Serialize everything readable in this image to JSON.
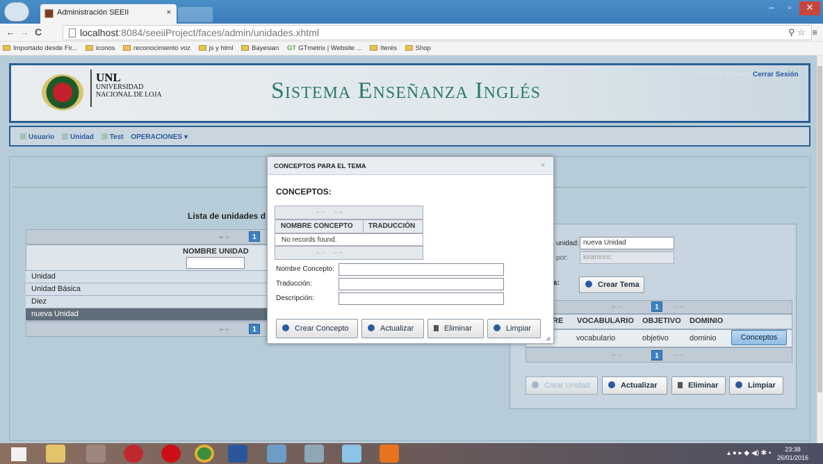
{
  "browser": {
    "tab_title": "Administración SEEII",
    "tab_close": "×",
    "url_host": "localhost",
    "url_rest": ":8084/seeiiProject/faces/admin/unidades.xhtml",
    "bookmarks": [
      "Importado desde Fir...",
      "iconos",
      "reconocimiento voz",
      "js y html",
      "Bayesian",
      "GTmetrix | Website ...",
      "Iterés",
      "Shop"
    ],
    "gt_prefix": "GT"
  },
  "header": {
    "unl": "UNL",
    "unl_sub": "UNIVERSIDAD NACIONAL DE LOJA",
    "logo_year": "1859",
    "system_title": "Sistema Enseñanza Inglés",
    "user_label": "Usuario: kiramonc",
    "logout": "Cerrar Sesión"
  },
  "menu": {
    "usuario": "Usuario",
    "unidad": "Unidad",
    "test": "Test",
    "operaciones": "OPERACIONES ▾"
  },
  "left": {
    "title": "Lista de unidades d",
    "column": "NOMBRE UNIDAD",
    "rows": [
      "Unidad",
      "Unidad Básica",
      "Diez",
      "nueva Unidad"
    ],
    "page": "1"
  },
  "right": {
    "nombre_label": "unidad:",
    "nombre_value": "nueva Unidad",
    "creado_label": "por:",
    "creado_value": "kiramonc",
    "temas_label": "s:",
    "crear_tema": "Crear Tema",
    "columns": [
      "RE",
      "VOCABULARIO",
      "OBJETIVO",
      "DOMINIO"
    ],
    "row": [
      "vocabulario",
      "objetivo",
      "dominio"
    ],
    "conceptos_btn": "Conceptos",
    "page": "1",
    "buttons": {
      "crear": "Crear Unidad",
      "actualizar": "Actualizar",
      "eliminar": "Eliminar",
      "limpiar": "Limpiar"
    }
  },
  "modal": {
    "title": "CONCEPTOS PARA EL TEMA",
    "close": "×",
    "heading": "CONCEPTOS:",
    "col_nombre": "NOMBRE CONCEPTO",
    "col_traduccion": "TRADUCCIÓN",
    "empty": "No records found.",
    "lbl_nombre": "Nombre Concepto:",
    "lbl_traduccion": "Traducción:",
    "lbl_descripcion": "Descripción:",
    "buttons": {
      "crear": "Crear Concepto",
      "actualizar": "Actualizar",
      "eliminar": "Eliminar",
      "limpiar": "Limpiar"
    }
  },
  "taskbar": {
    "time": "23:38",
    "date": "26/01/2016"
  }
}
